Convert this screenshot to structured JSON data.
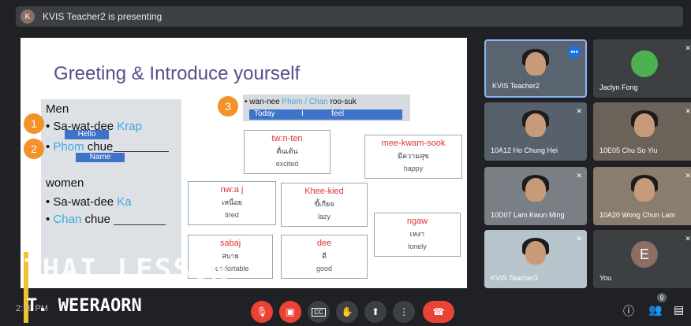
{
  "header": {
    "avatar_letter": "K",
    "presenting_text": "KVIS Teacher2 is presenting"
  },
  "slide": {
    "title": "Greeting & Introduce yourself",
    "men_label": "Men",
    "men_line1_prefix": "• Sa-wat-dee ",
    "men_line1_blue": "Krap",
    "hello_bar": "Hello",
    "men_line2_blue": "Phom",
    "men_line2_suffix": " chue",
    "name_bar": "Name",
    "women_label": "women",
    "women_line1_prefix": "• Sa-wat-dee ",
    "women_line1_blue": "Ka",
    "women_line2_blue": "Chan",
    "women_line2_suffix": " chue",
    "num1": "1",
    "num2": "2",
    "num3": "3",
    "phrase_prefix": "• wan-nee ",
    "phrase_blue": "Phom / Chan",
    "phrase_suffix": " roo-suk",
    "bar_today": "Today",
    "bar_i": "I",
    "bar_feel": "feel",
    "cards": [
      {
        "roman": "tw:n-ten",
        "thai": "ตื่นเต้น",
        "english": "excited"
      },
      {
        "roman": "mee-kwam-sook",
        "thai": "มีความสุข",
        "english": "happy"
      },
      {
        "roman": "nw:a j",
        "thai": "เหนื่อย",
        "english": "tired"
      },
      {
        "roman": "Khee-kied",
        "thai": "ขี้เกียจ",
        "english": "lazy"
      },
      {
        "roman": "ngaw",
        "thai": "เหงา",
        "english": "lonely"
      },
      {
        "roman": "sabaj",
        "thai": "สบาย",
        "english": "comfortable"
      },
      {
        "roman": "dee",
        "thai": "ดี",
        "english": "good"
      }
    ]
  },
  "watermark": {
    "line1": "THAI LESSON",
    "line2": "T. WEERAORN",
    "time": "2:19 PM"
  },
  "participants": [
    {
      "name": "KVIS Teacher2",
      "muted": false,
      "type": "video"
    },
    {
      "name": "Jaclyn Fong",
      "muted": true,
      "type": "avatar"
    },
    {
      "name": "10A12 Ho Chung Hei",
      "muted": true,
      "type": "video"
    },
    {
      "name": "10E05 Chu So Yiu",
      "muted": true,
      "type": "video"
    },
    {
      "name": "10D07 Lam Kwun Ming",
      "muted": true,
      "type": "video"
    },
    {
      "name": "10A20 Wong Chun Lam",
      "muted": true,
      "type": "video"
    },
    {
      "name": "KVIS Teacher3",
      "muted": true,
      "type": "video"
    },
    {
      "name": "You",
      "muted": true,
      "type": "letter",
      "letter": "E"
    }
  ],
  "controls": {
    "mic_icon": "mic-off-icon",
    "cam_icon": "camera-off-icon",
    "captions_label": "CC",
    "hand_icon": "raise-hand-icon",
    "present_icon": "present-icon",
    "more_icon": "more-icon",
    "end_icon": "end-call-icon",
    "people_count": "9"
  }
}
